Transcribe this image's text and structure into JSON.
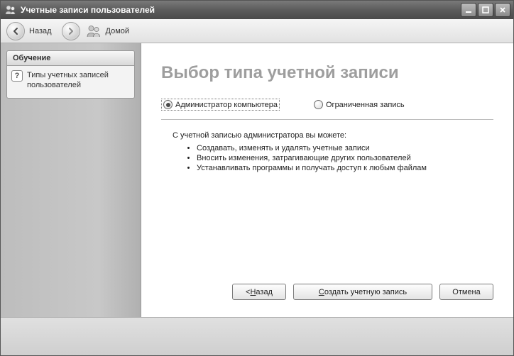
{
  "window": {
    "title": "Учетные записи пользователей"
  },
  "toolbar": {
    "back_label": "Назад",
    "home_label": "Домой"
  },
  "sidebar": {
    "panel_title": "Обучение",
    "link1": "Типы учетных записей пользователей"
  },
  "main": {
    "page_title": "Выбор типа учетной записи",
    "radio_admin": "Администратор компьютера",
    "radio_limited": "Ограниченная запись",
    "desc_intro": "С учетной записью администратора вы можете:",
    "bullets": {
      "0": "Создавать, изменять и удалять учетные записи",
      "1": "Вносить изменения, затрагивающие других пользователей",
      "2": "Устанавливать программы и получать доступ к любым файлам"
    },
    "btn_back_prefix": "< ",
    "btn_back_u": "Н",
    "btn_back_rest": "азад",
    "btn_create_u": "С",
    "btn_create_rest": "оздать учетную запись",
    "btn_cancel": "Отмена"
  }
}
